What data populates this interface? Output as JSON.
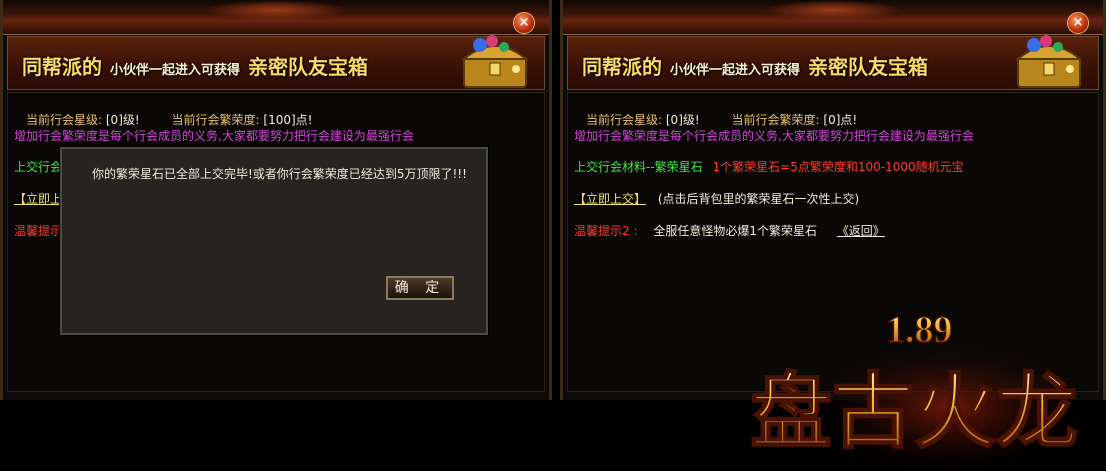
{
  "left_panel": {
    "banner": {
      "part1": "同帮派的",
      "part2": "小伙伴一起进入可获得",
      "part3": "亲密队友宝箱"
    },
    "close": "×",
    "guild_star_label": "当前行会星级:",
    "guild_star_value": "[0]级!",
    "guild_prosperity_label": "当前行会繁荣度:",
    "guild_prosperity_value": "[100]点!",
    "description": "增加行会繁荣度是每个行会成员的义务,大家都要努力把行会建设为最强行会",
    "submit_partial": "上交行会",
    "submit_link_partial": "【立即上",
    "tip_partial": "温馨提示:"
  },
  "dialog": {
    "message": "你的繁荣星石已全部上交完毕!或者你行会繁荣度已经达到5万顶限了!!!",
    "ok": "确 定"
  },
  "right_panel": {
    "banner": {
      "part1": "同帮派的",
      "part2": "小伙伴一起进入可获得",
      "part3": "亲密队友宝箱"
    },
    "close": "×",
    "guild_star_label": "当前行会星级:",
    "guild_star_value": "[0]级!",
    "guild_prosperity_label": "当前行会繁荣度:",
    "guild_prosperity_value": "[0]点!",
    "description": "增加行会繁荣度是每个行会成员的义务,大家都要努力把行会建设为最强行会",
    "material_label": "上交行会材料--繁荣星石",
    "material_reward": "1个繁荣星石=5点繁荣度和100-1000随机元宝",
    "submit_link": "【立即上交】",
    "submit_note": "(点击后背包里的繁荣星石一次性上交)",
    "tip_label": "温馨提示2 :",
    "tip_text": "全服任意怪物必爆1个繁荣星石",
    "back_link": "《返回》"
  },
  "logo": {
    "version": "1.89",
    "title": "盘古火龙"
  }
}
